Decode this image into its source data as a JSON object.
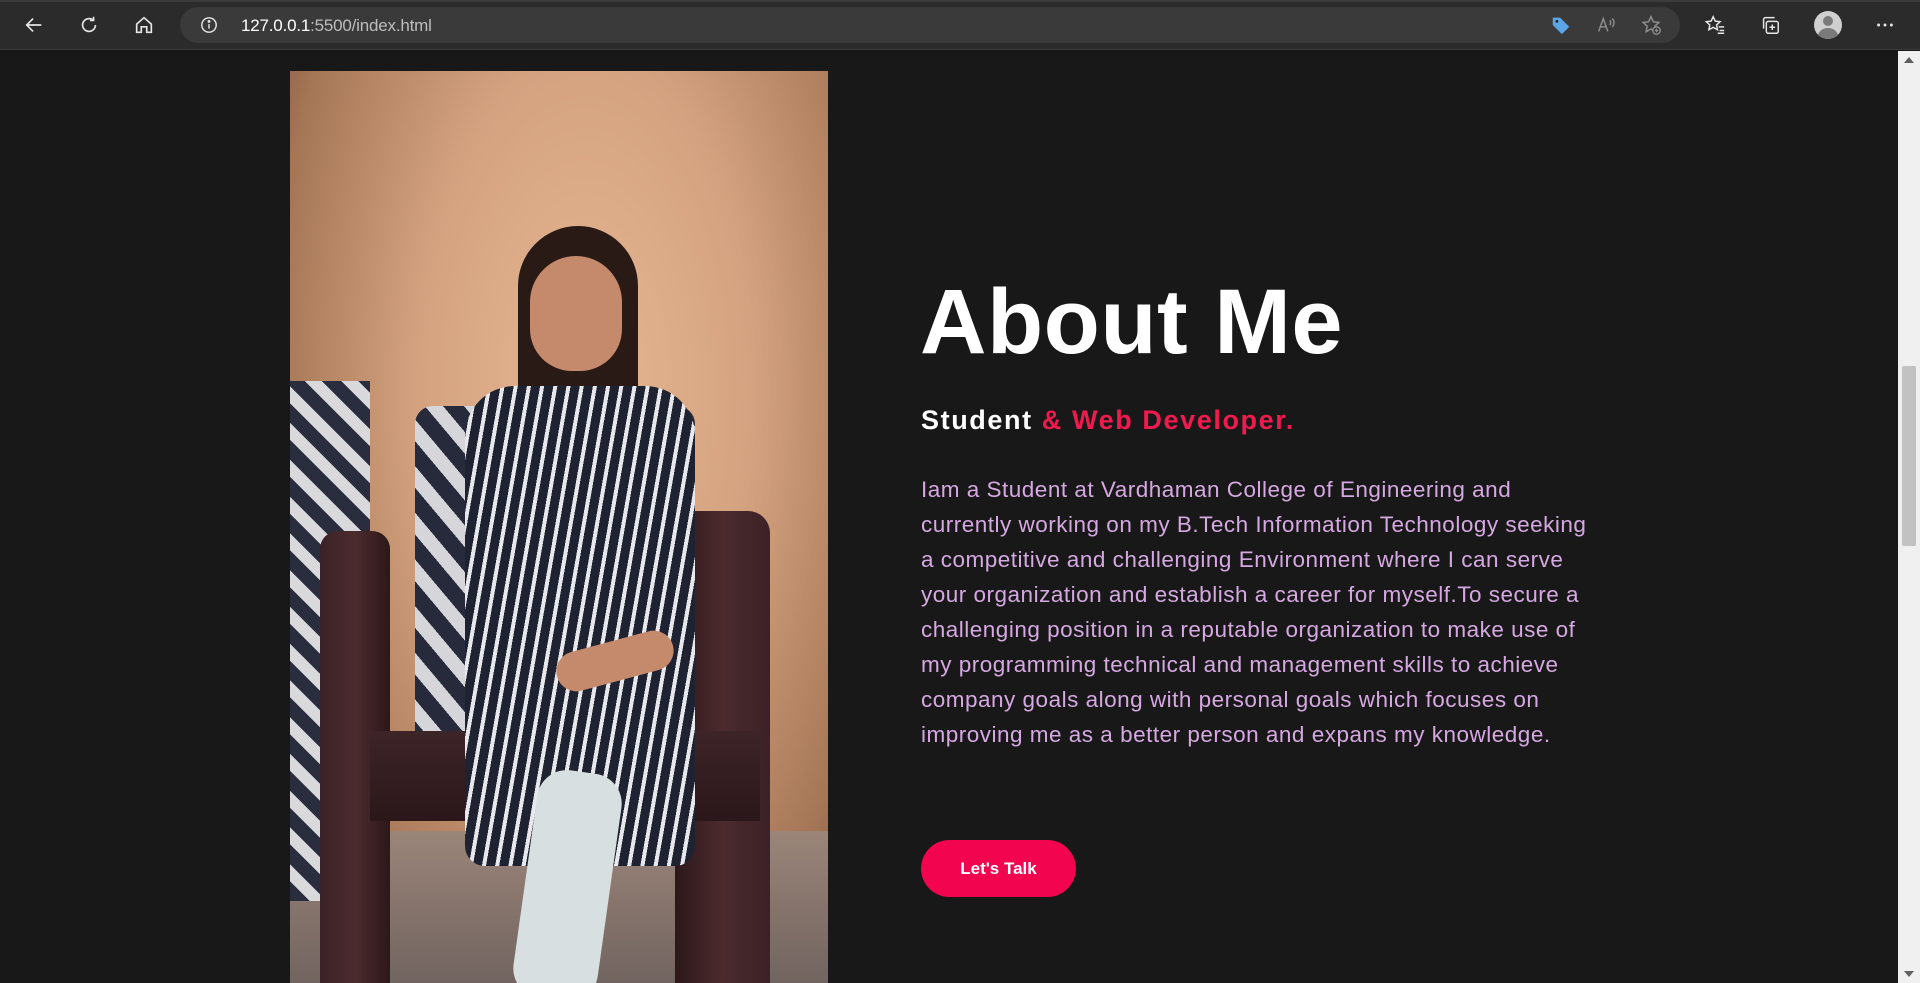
{
  "browser": {
    "url_host": "127.0.0.1",
    "url_rest": ":5500/index.html",
    "icons": [
      "back-icon",
      "refresh-icon",
      "home-icon",
      "info-icon",
      "tag-icon",
      "read-aloud-icon",
      "add-favorite-icon",
      "favorites-icon",
      "collections-icon",
      "profile-icon",
      "more-icon"
    ]
  },
  "about": {
    "title": "About Me",
    "subtitle_plain": "Student ",
    "subtitle_accent": "& Web Developer.",
    "bio": "Iam a Student at Vardhaman College of Engineering and currently working on my B.Tech Information Technology seeking a competitive and challenging Environment where I can serve your organization and establish a career for myself.To secure a challenging position in a reputable organization to make use of my programming technical and management skills to achieve company goals along with personal goals which focuses on improving me as a better person and expans my knowledge.",
    "cta_label": "Let's Talk"
  },
  "colors": {
    "background": "#181818",
    "accent": "#f3044e",
    "bio_text": "#d6a8e2",
    "heading": "#ffffff"
  }
}
